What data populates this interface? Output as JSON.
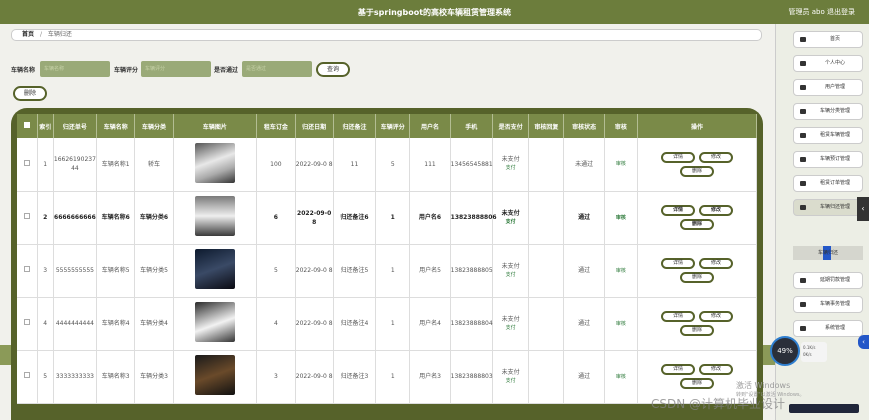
{
  "header": {
    "title": "基于springboot的高校车辆租赁管理系统",
    "user_text": "管理员 abo 退出登录"
  },
  "breadcrumb": {
    "home": "首页",
    "separator": "/",
    "current": "车辆归还"
  },
  "search": {
    "name_label": "车辆名称",
    "name_placeholder": "车辆名称",
    "score_label": "车辆评分",
    "score_placeholder": "车辆评分",
    "pass_label": "是否通过",
    "pass_placeholder": "是否通过",
    "query_button": "查询",
    "delete_button": "删除"
  },
  "table": {
    "headers": [
      "",
      "索引",
      "归还单号",
      "车辆名称",
      "车辆分类",
      "车辆图片",
      "租车订金",
      "归还日期",
      "归还备注",
      "车辆评分",
      "用户名",
      "手机",
      "是否支付",
      "审核回复",
      "审核状态",
      "审核",
      "操作"
    ],
    "rows": [
      {
        "index": "1",
        "no": "16626190237 44",
        "name": "车辆名称1",
        "category": "轿车",
        "deposit": "100",
        "date": "2022-09-0 8",
        "remark": "11",
        "score": "5",
        "user": "111",
        "phone": "13456545881",
        "paid": "未支付",
        "pay_link": "支付",
        "reply": "",
        "status": "未通过",
        "review": "审核"
      },
      {
        "index": "2",
        "no": "6666666666",
        "name": "车辆名称6",
        "category": "车辆分类6",
        "deposit": "6",
        "date": "2022-09-0 8",
        "remark": "归还备注6",
        "score": "1",
        "user": "用户名6",
        "phone": "13823888806",
        "paid": "未支付",
        "pay_link": "支付",
        "reply": "",
        "status": "通过",
        "review": "审核"
      },
      {
        "index": "3",
        "no": "5555555555",
        "name": "车辆名称5",
        "category": "车辆分类5",
        "deposit": "5",
        "date": "2022-09-0 8",
        "remark": "归还备注5",
        "score": "1",
        "user": "用户名5",
        "phone": "13823888805",
        "paid": "未支付",
        "pay_link": "支付",
        "reply": "",
        "status": "通过",
        "review": "审核"
      },
      {
        "index": "4",
        "no": "4444444444",
        "name": "车辆名称4",
        "category": "车辆分类4",
        "deposit": "4",
        "date": "2022-09-0 8",
        "remark": "归还备注4",
        "score": "1",
        "user": "用户名4",
        "phone": "13823888804",
        "paid": "未支付",
        "pay_link": "支付",
        "reply": "",
        "status": "通过",
        "review": "审核"
      },
      {
        "index": "5",
        "no": "3333333333",
        "name": "车辆名称3",
        "category": "车辆分类3",
        "deposit": "3",
        "date": "2022-09-0 8",
        "remark": "归还备注3",
        "score": "1",
        "user": "用户名3",
        "phone": "13823888803",
        "paid": "未支付",
        "pay_link": "支付",
        "reply": "",
        "status": "通过",
        "review": "审核"
      }
    ],
    "ops": {
      "detail": "详情",
      "edit": "修改",
      "delete": "删除"
    }
  },
  "sidebar": {
    "items": [
      {
        "label": "首页",
        "icon": "home-icon"
      },
      {
        "label": "个人中心",
        "icon": "person-icon"
      },
      {
        "label": "用户管理",
        "icon": "grid-icon"
      },
      {
        "label": "车辆分类管理",
        "icon": "grid-icon"
      },
      {
        "label": "租赁车辆管理",
        "icon": "car-icon"
      },
      {
        "label": "车辆预订管理",
        "icon": "lock-icon"
      },
      {
        "label": "租赁订单管理",
        "icon": "grid-icon"
      },
      {
        "label": "车辆归还管理",
        "icon": "grid-icon"
      },
      {
        "label": "延期罚款管理",
        "icon": "grid-icon"
      },
      {
        "label": "车辆事务管理",
        "icon": "grid-icon"
      },
      {
        "label": "系统管理",
        "icon": "briefcase-icon"
      }
    ],
    "sub_item": "车辆归还"
  },
  "widget": {
    "percent": "49%",
    "up": "0.1K/s",
    "down": "0K/s"
  },
  "activation": {
    "line1": "激活 Windows",
    "line2": "转到\"设置\"以激活 Windows。"
  },
  "watermark": "CSDN @计算机毕业设计"
}
